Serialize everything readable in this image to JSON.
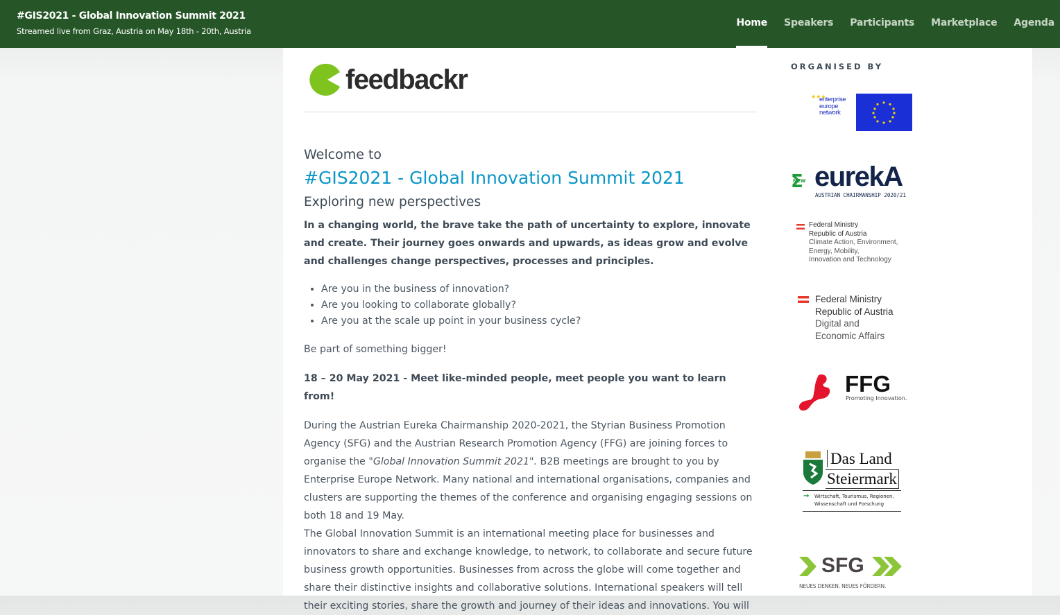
{
  "header": {
    "title": "#GIS2021 - Global Innovation Summit 2021",
    "subtitle": "Streamed live from Graz, Austria on May 18th - 20th, Austria"
  },
  "nav": [
    {
      "label": "Home",
      "active": true
    },
    {
      "label": "Speakers"
    },
    {
      "label": "Participants"
    },
    {
      "label": "Marketplace"
    },
    {
      "label": "Agenda"
    }
  ],
  "main": {
    "logo_text": "feedbackr",
    "welcome": "Welcome to",
    "title": "#GIS2021 - Global Innovation Summit 2021",
    "tagline": "Exploring new perspectives",
    "intro": "In a changing world, the brave take the path of uncertainty to explore, innovate and create. Their journey goes onwards and upwards, as ideas grow and evolve and challenges change perspectives, processes and principles.",
    "bullets": [
      "Are you in the business of innovation?",
      "Are you looking to collaborate globally?",
      "Are you at the scale up point in your business cycle?"
    ],
    "be_part": "Be part of something bigger!",
    "dates": "18 – 20 May 2021 - Meet like-minded people, meet people you want to learn from!",
    "para_a": "During the Austrian Eureka Chairmanship 2020-2021, the Styrian Business Promotion Agency (SFG) and the Austrian Research Promotion Agency (FFG) are joining forces to organise the ",
    "para_a_italic": "\"Global Innovation Summit 2021\".",
    "para_a_rest": " B2B meetings are brought to you by Enterprise Europe Network. Many national and international organisations, companies and clusters are supporting the themes of the conference and organising engaging sessions on both 18 and 19 May.",
    "para_b": "The Global Innovation Summit is an international meeting place for businesses and innovators to share and exchange knowledge, to network, to collaborate and secure future business growth opportunities. Businesses from across the globe will come together and share their distinctive insights and collaborative solutions. International speakers will tell their exciting stories, share the growth and journey of their ideas and innovations. You will"
  },
  "side": {
    "heading": "ORGANISED BY",
    "een": {
      "l1": "enterprise",
      "l2": "europe",
      "l3": "network"
    },
    "eureka": {
      "new": "NEW",
      "word": "eurekA",
      "sub": "AUSTRIAN CHAIRMANSHIP 2020/21"
    },
    "bmk": {
      "l1": "Federal Ministry",
      "l2": "Republic of Austria",
      "l3": "Climate Action, Environment,",
      "l4": "Energy, Mobility,",
      "l5": "Innovation and Technology"
    },
    "bmdw": {
      "l1": "Federal Ministry",
      "l2": "Republic of Austria",
      "l3": "Digital and",
      "l4": "Economic Affairs"
    },
    "ffg": {
      "name": "FFG",
      "sub": "Promoting Innovation."
    },
    "stmk": {
      "l1": "Das Land",
      "l2": "Steiermark",
      "l3": "Wirtschaft, Tourismus, Regionen,",
      "l4": "Wissenschaft und Forschung"
    },
    "sfg": {
      "name": "SFG",
      "sub": "NEUES DENKEN. NEUES FÖRDERN."
    }
  },
  "colors": {
    "header": "#265628",
    "accent": "#0a96c8",
    "lime": "#7fc41e"
  }
}
